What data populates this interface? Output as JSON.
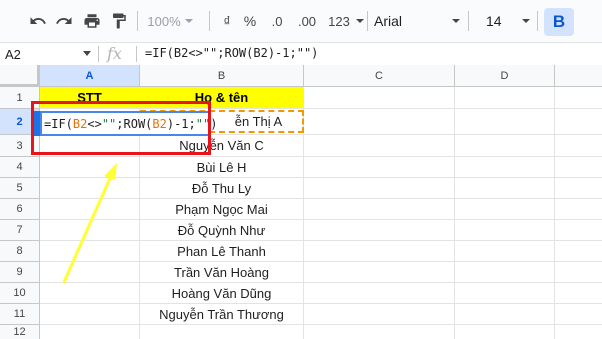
{
  "toolbar": {
    "zoom": "100%",
    "currency": "₫",
    "percent": "%",
    "dec_decrease": ".0",
    "dec_increase": ".00",
    "format_more": "123",
    "font": "Arial",
    "font_size": "14",
    "bold": "B",
    "icons": [
      "undo-icon",
      "redo-icon",
      "print-icon",
      "paint-format-icon",
      "chevron-down-icon"
    ]
  },
  "formula_bar": {
    "name_box": "A2",
    "fx": "fx",
    "formula": "=IF(B2<>\"\";ROW(B2)-1;\"\")"
  },
  "columns": [
    "A",
    "B",
    "C",
    "D"
  ],
  "rows": [
    "1",
    "2",
    "3",
    "4",
    "5",
    "6",
    "7",
    "8",
    "9",
    "10",
    "11",
    "12"
  ],
  "cells": {
    "a1": "STT",
    "b1": "Họ & tên",
    "b2_partial": "ễn Thị A",
    "b": [
      "Nguyễn Văn C",
      "Bùi Lê H",
      "Đỗ Thu Ly",
      "Phạm Ngọc Mai",
      "Đỗ Quỳnh Như",
      "Phan Lê Thanh",
      "Trần Văn Hoàng",
      "Hoàng Văn Dũng",
      "Nguyễn Trần Thương"
    ]
  },
  "editor": {
    "p1": "=IF(",
    "r1": "B2",
    "p2": "<>",
    "s1": "\"\"",
    "p3": ";ROW(",
    "r2": "B2",
    "p4": ")-1;",
    "s2": "\"\"",
    "p5": ")"
  },
  "colors": {
    "header_fill": "#ffff00",
    "annotation_red": "#e8141c",
    "annotation_arrow": "#ffff33",
    "ref_orange": "#e8710a",
    "selection_blue": "#4a86e8"
  }
}
